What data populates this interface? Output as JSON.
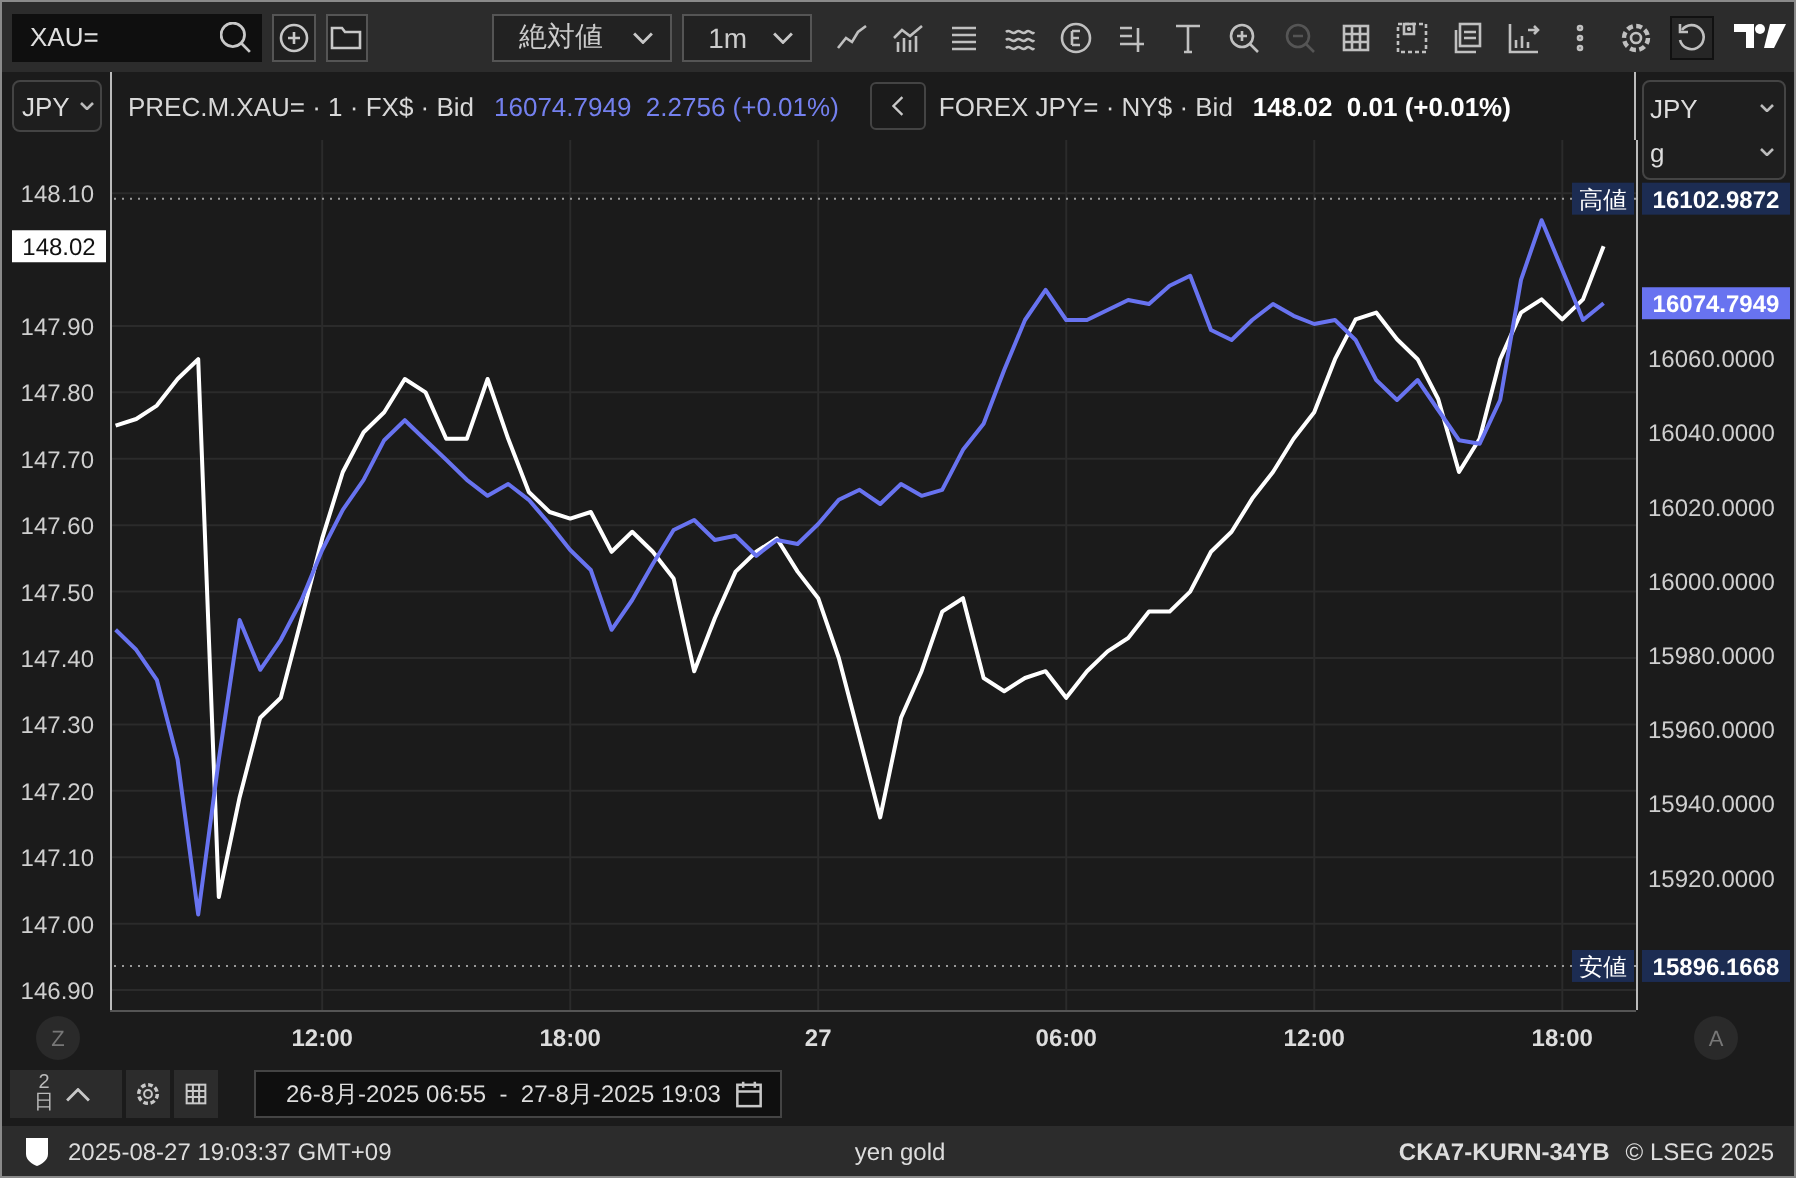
{
  "toolbar": {
    "search": {
      "value": "XAU="
    },
    "buttons": [
      {
        "kind": "add"
      },
      {
        "kind": "folder"
      }
    ],
    "dropdowns": [
      {
        "label": "絶対値"
      },
      {
        "label": "1m"
      }
    ],
    "tools": [
      {
        "kind": "line",
        "disabled": false,
        "selected": false
      },
      {
        "kind": "bars",
        "disabled": false,
        "selected": false
      },
      {
        "kind": "list",
        "disabled": false,
        "selected": false
      },
      {
        "kind": "waves",
        "disabled": false,
        "selected": false
      },
      {
        "kind": "events",
        "disabled": false,
        "selected": false
      },
      {
        "kind": "draw",
        "disabled": false,
        "selected": false
      },
      {
        "kind": "text",
        "disabled": false,
        "selected": false
      },
      {
        "kind": "zoom-in",
        "disabled": false,
        "selected": false
      },
      {
        "kind": "zoom-out",
        "disabled": true,
        "selected": false
      },
      {
        "kind": "table",
        "disabled": false,
        "selected": false
      },
      {
        "kind": "snapshot",
        "disabled": false,
        "selected": false
      },
      {
        "kind": "document",
        "disabled": false,
        "selected": false
      },
      {
        "kind": "export",
        "disabled": false,
        "selected": false
      },
      {
        "kind": "more",
        "disabled": false,
        "selected": false
      },
      {
        "kind": "settings",
        "disabled": false,
        "selected": false
      },
      {
        "kind": "reset",
        "disabled": false,
        "selected": true
      }
    ]
  },
  "legend": {
    "currency": "JPY",
    "items": [
      {
        "kind": "gold",
        "symbol": "PREC.M.XAU= · 1 · FX$ · Bid",
        "quote": "16074.7949  2.2756 (+0.01%)"
      },
      {
        "kind": "fx",
        "symbol": "FOREX JPY= · NY$ · Bid",
        "quote": "148.02  0.01 (+0.01%)"
      }
    ]
  },
  "right_selects": [
    {
      "value": "JPY"
    },
    {
      "value": "g"
    }
  ],
  "price_chart": {
    "last_price_tag": "148.02",
    "chart_data": {
      "type": "line",
      "grid": true,
      "xlim": [
        "2025-08-26T06:52",
        "2025-08-27T19:47"
      ],
      "ylim": [
        146.87,
        148.18
      ],
      "x": [
        "2025-08-26T07:00",
        "2025-08-26T07:30",
        "2025-08-26T08:00",
        "2025-08-26T08:30",
        "2025-08-26T09:00",
        "2025-08-26T09:30",
        "2025-08-26T10:00",
        "2025-08-26T10:30",
        "2025-08-26T11:00",
        "2025-08-26T11:30",
        "2025-08-26T12:00",
        "2025-08-26T12:30",
        "2025-08-26T13:00",
        "2025-08-26T13:30",
        "2025-08-26T14:00",
        "2025-08-26T14:30",
        "2025-08-26T15:00",
        "2025-08-26T15:30",
        "2025-08-26T16:00",
        "2025-08-26T16:30",
        "2025-08-26T17:00",
        "2025-08-26T17:30",
        "2025-08-26T18:00",
        "2025-08-26T18:30",
        "2025-08-26T19:00",
        "2025-08-26T19:30",
        "2025-08-26T20:00",
        "2025-08-26T20:30",
        "2025-08-26T21:00",
        "2025-08-26T21:30",
        "2025-08-26T22:00",
        "2025-08-26T22:30",
        "2025-08-26T23:00",
        "2025-08-26T23:30",
        "2025-08-27T00:00",
        "2025-08-27T00:30",
        "2025-08-27T01:00",
        "2025-08-27T01:30",
        "2025-08-27T02:00",
        "2025-08-27T02:30",
        "2025-08-27T03:00",
        "2025-08-27T03:30",
        "2025-08-27T04:00",
        "2025-08-27T04:30",
        "2025-08-27T05:00",
        "2025-08-27T05:30",
        "2025-08-27T06:00",
        "2025-08-27T06:30",
        "2025-08-27T07:00",
        "2025-08-27T07:30",
        "2025-08-27T08:00",
        "2025-08-27T08:30",
        "2025-08-27T09:00",
        "2025-08-27T09:30",
        "2025-08-27T10:00",
        "2025-08-27T10:30",
        "2025-08-27T11:00",
        "2025-08-27T11:30",
        "2025-08-27T12:00",
        "2025-08-27T12:30",
        "2025-08-27T13:00",
        "2025-08-27T13:30",
        "2025-08-27T14:00",
        "2025-08-27T14:30",
        "2025-08-27T15:00",
        "2025-08-27T15:30",
        "2025-08-27T16:00",
        "2025-08-27T16:30",
        "2025-08-27T17:00",
        "2025-08-27T17:30",
        "2025-08-27T18:00",
        "2025-08-27T18:30",
        "2025-08-27T19:00"
      ],
      "xticks": [
        {
          "value": "2025-08-26T12:00",
          "label": "12:00"
        },
        {
          "value": "2025-08-26T18:00",
          "label": "18:00"
        },
        {
          "value": "2025-08-27T00:00",
          "label": "27"
        },
        {
          "value": "2025-08-27T06:00",
          "label": "06:00"
        },
        {
          "value": "2025-08-27T12:00",
          "label": "12:00"
        },
        {
          "value": "2025-08-27T18:00",
          "label": "18:00"
        }
      ],
      "yticks": [
        {
          "value": 146.9,
          "label": "146.90"
        },
        {
          "value": 147.0,
          "label": "147.00"
        },
        {
          "value": 147.1,
          "label": "147.10"
        },
        {
          "value": 147.2,
          "label": "147.20"
        },
        {
          "value": 147.3,
          "label": "147.30"
        },
        {
          "value": 147.4,
          "label": "147.40"
        },
        {
          "value": 147.5,
          "label": "147.50"
        },
        {
          "value": 147.6,
          "label": "147.60"
        },
        {
          "value": 147.7,
          "label": "147.70"
        },
        {
          "value": 147.8,
          "label": "147.80"
        },
        {
          "value": 147.9,
          "label": "147.90"
        },
        {
          "value": 148.1,
          "label": "148.10"
        }
      ],
      "series": [
        {
          "color": "#ffffff",
          "values": [
            147.75,
            147.76,
            147.78,
            147.82,
            147.85,
            147.04,
            147.19,
            147.31,
            147.34,
            147.46,
            147.58,
            147.68,
            147.74,
            147.77,
            147.82,
            147.8,
            147.73,
            147.73,
            147.82,
            147.73,
            147.65,
            147.62,
            147.61,
            147.62,
            147.56,
            147.59,
            147.56,
            147.52,
            147.38,
            147.46,
            147.53,
            147.56,
            147.58,
            147.53,
            147.49,
            147.4,
            147.28,
            147.16,
            147.31,
            147.38,
            147.47,
            147.49,
            147.37,
            147.35,
            147.37,
            147.38,
            147.34,
            147.38,
            147.41,
            147.43,
            147.47,
            147.47,
            147.5,
            147.56,
            147.59,
            147.64,
            147.68,
            147.73,
            147.77,
            147.85,
            147.91,
            147.92,
            147.88,
            147.85,
            147.79,
            147.68,
            147.73,
            147.85,
            147.92,
            147.94,
            147.91,
            147.94,
            148.02
          ]
        }
      ]
    }
  },
  "gold_chart": {
    "last_price_tag": "16074.7949",
    "chart_data": {
      "type": "line",
      "xlim": [
        "2025-08-26T06:52",
        "2025-08-27T19:47"
      ],
      "ylim": [
        15884.3,
        16118.8
      ],
      "x": [
        "2025-08-26T07:00",
        "2025-08-26T07:30",
        "2025-08-26T08:00",
        "2025-08-26T08:30",
        "2025-08-26T09:00",
        "2025-08-26T09:30",
        "2025-08-26T10:00",
        "2025-08-26T10:30",
        "2025-08-26T11:00",
        "2025-08-26T11:30",
        "2025-08-26T12:00",
        "2025-08-26T12:30",
        "2025-08-26T13:00",
        "2025-08-26T13:30",
        "2025-08-26T14:00",
        "2025-08-26T14:30",
        "2025-08-26T15:00",
        "2025-08-26T15:30",
        "2025-08-26T16:00",
        "2025-08-26T16:30",
        "2025-08-26T17:00",
        "2025-08-26T17:30",
        "2025-08-26T18:00",
        "2025-08-26T18:30",
        "2025-08-26T19:00",
        "2025-08-26T19:30",
        "2025-08-26T20:00",
        "2025-08-26T20:30",
        "2025-08-26T21:00",
        "2025-08-26T21:30",
        "2025-08-26T22:00",
        "2025-08-26T22:30",
        "2025-08-26T23:00",
        "2025-08-26T23:30",
        "2025-08-27T00:00",
        "2025-08-27T00:30",
        "2025-08-27T01:00",
        "2025-08-27T01:30",
        "2025-08-27T02:00",
        "2025-08-27T02:30",
        "2025-08-27T03:00",
        "2025-08-27T03:30",
        "2025-08-27T04:00",
        "2025-08-27T04:30",
        "2025-08-27T05:00",
        "2025-08-27T05:30",
        "2025-08-27T06:00",
        "2025-08-27T06:30",
        "2025-08-27T07:00",
        "2025-08-27T07:30",
        "2025-08-27T08:00",
        "2025-08-27T08:30",
        "2025-08-27T09:00",
        "2025-08-27T09:30",
        "2025-08-27T10:00",
        "2025-08-27T10:30",
        "2025-08-27T11:00",
        "2025-08-27T11:30",
        "2025-08-27T12:00",
        "2025-08-27T12:30",
        "2025-08-27T13:00",
        "2025-08-27T13:30",
        "2025-08-27T14:00",
        "2025-08-27T14:30",
        "2025-08-27T15:00",
        "2025-08-27T15:30",
        "2025-08-27T16:00",
        "2025-08-27T16:30",
        "2025-08-27T17:00",
        "2025-08-27T17:30",
        "2025-08-27T18:00",
        "2025-08-27T18:30",
        "2025-08-27T19:00"
      ],
      "yticks": [
        {
          "value": 15920,
          "label": "15920.0000"
        },
        {
          "value": 15940,
          "label": "15940.0000"
        },
        {
          "value": 15960,
          "label": "15960.0000"
        },
        {
          "value": 15980,
          "label": "15980.0000"
        },
        {
          "value": 16000,
          "label": "16000.0000"
        },
        {
          "value": 16020,
          "label": "16020.0000"
        },
        {
          "value": 16040,
          "label": "16040.0000"
        },
        {
          "value": 16060,
          "label": "16060.0000"
        }
      ],
      "series": [
        {
          "color": "#6873f0",
          "values": [
            15986.8,
            15981.4,
            15973.3,
            15951.8,
            15910.0,
            15951.8,
            15989.4,
            15976.0,
            15984.1,
            15994.8,
            16008.3,
            16019.1,
            16027.2,
            16037.9,
            16043.3,
            16037.9,
            16032.6,
            16027.2,
            16022.9,
            16026.1,
            16021.8,
            16015.3,
            16008.3,
            16002.9,
            15986.8,
            15994.8,
            16004.5,
            16013.7,
            16016.4,
            16011.0,
            16012.1,
            16006.7,
            16011.0,
            16009.9,
            16015.3,
            16021.8,
            16024.5,
            16020.7,
            16026.1,
            16022.9,
            16024.5,
            16035.3,
            16042.3,
            16056.8,
            16070.3,
            16078.4,
            16070.3,
            16070.3,
            16073.0,
            16075.7,
            16074.6,
            16079.5,
            16082.2,
            16067.6,
            16064.9,
            16070.3,
            16074.6,
            16071.4,
            16069.2,
            16070.3,
            16064.9,
            16054.1,
            16048.7,
            16054.1,
            16046.0,
            16037.9,
            16036.9,
            16048.7,
            16081.1,
            16097.2,
            16083.8,
            16070.3,
            16074.8
          ]
        }
      ],
      "ref_lines": [
        {
          "axis": "y",
          "value": 16102.9872,
          "label": "16102.9872"
        },
        {
          "axis": "y",
          "value": 15896.1668,
          "label": "15896.1668"
        }
      ],
      "annotations": [
        {
          "text": "高値",
          "y": 16102.9872
        },
        {
          "text": "安値",
          "y": 15896.1668
        }
      ]
    }
  },
  "axis_buttons": [
    {
      "label": "Z"
    },
    {
      "label": "A"
    }
  ],
  "bottom": {
    "range_button": "2日",
    "date_range": "26-8月-2025 06:55  -  27-8月-2025 19:03"
  },
  "status_bar": {
    "timestamp": "2025-08-27 19:03:37 GMT+09",
    "title": "yen gold",
    "session_id": "CKA7-KURN-34YB",
    "copyright": "© LSEG 2025"
  }
}
